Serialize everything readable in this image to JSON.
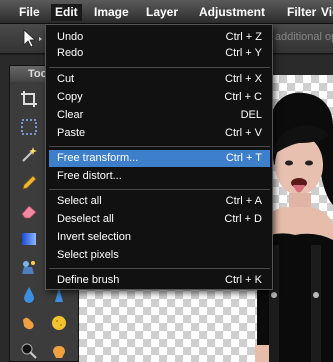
{
  "menubar": {
    "items": [
      {
        "label": "File"
      },
      {
        "label": "Edit"
      },
      {
        "label": "Image"
      },
      {
        "label": "Layer"
      },
      {
        "label": "Adjustment"
      },
      {
        "label": "Filter"
      },
      {
        "label": "Vie"
      }
    ]
  },
  "options_bar": {
    "hint": "tool has no additional opti"
  },
  "tools_panel": {
    "title": "Too",
    "tools": [
      {
        "icon": "crop-icon"
      },
      {
        "icon": "marquee-icon"
      },
      {
        "icon": "magic-wand-icon"
      },
      {
        "icon": "pencil-icon"
      },
      {
        "icon": "eraser-icon"
      },
      {
        "icon": "gradient-icon"
      },
      {
        "icon": "clone-stamp-icon"
      },
      {
        "icon": "blur-icon"
      },
      {
        "icon": "smudge-icon"
      },
      {
        "icon": "dodge-icon"
      }
    ]
  },
  "edit_menu": {
    "items": [
      {
        "label": "Undo",
        "shortcut": "Ctrl + Z"
      },
      {
        "label": "Redo",
        "shortcut": "Ctrl + Y"
      },
      {
        "label": "Cut",
        "shortcut": "Ctrl + X"
      },
      {
        "label": "Copy",
        "shortcut": "Ctrl + C"
      },
      {
        "label": "Clear",
        "shortcut": "DEL"
      },
      {
        "label": "Paste",
        "shortcut": "Ctrl + V"
      },
      {
        "label": "Free transform...",
        "shortcut": "Ctrl + T",
        "highlighted": true
      },
      {
        "label": "Free distort...",
        "shortcut": ""
      },
      {
        "label": "Select all",
        "shortcut": "Ctrl + A"
      },
      {
        "label": "Deselect all",
        "shortcut": "Ctrl + D"
      },
      {
        "label": "Invert selection",
        "shortcut": ""
      },
      {
        "label": "Select pixels",
        "shortcut": ""
      },
      {
        "label": "Define brush",
        "shortcut": "Ctrl + K"
      }
    ]
  },
  "colors": {
    "highlight": "#3e7fcc",
    "menu_bg": "#111111"
  }
}
